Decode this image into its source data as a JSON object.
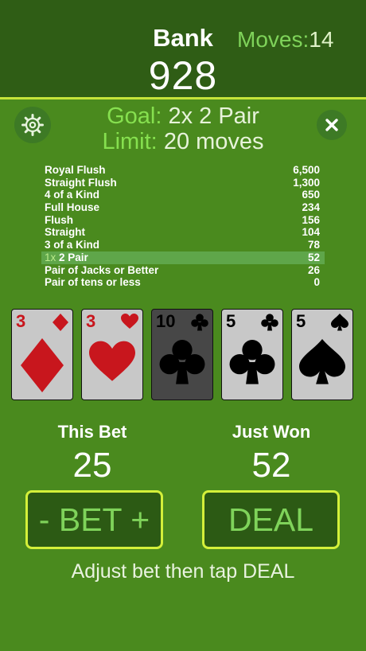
{
  "header": {
    "bank_label": "Bank",
    "bank_value": "928",
    "moves_label": "Moves:",
    "moves_value": "14"
  },
  "goal": {
    "goal_label": "Goal:",
    "goal_value": "2x 2 Pair",
    "limit_label": "Limit:",
    "limit_value": "20 moves"
  },
  "paytable": [
    {
      "hand": "Royal Flush",
      "payout": "6,500"
    },
    {
      "hand": "Straight Flush",
      "payout": "1,300"
    },
    {
      "hand": "4 of a Kind",
      "payout": "650"
    },
    {
      "hand": "Full House",
      "payout": "234"
    },
    {
      "hand": "Flush",
      "payout": "156"
    },
    {
      "hand": "Straight",
      "payout": "104"
    },
    {
      "hand": "3 of a Kind",
      "payout": "78"
    },
    {
      "prefix": "1x",
      "hand": "2 Pair",
      "payout": "52",
      "highlight": true
    },
    {
      "hand": "Pair of Jacks or Better",
      "payout": "26"
    },
    {
      "hand": "Pair of tens or less",
      "payout": "0"
    }
  ],
  "cards": [
    {
      "rank": "3",
      "suit": "diamond",
      "held": false
    },
    {
      "rank": "3",
      "suit": "heart",
      "held": false
    },
    {
      "rank": "10",
      "suit": "club",
      "held": true
    },
    {
      "rank": "5",
      "suit": "club",
      "held": false
    },
    {
      "rank": "5",
      "suit": "spade",
      "held": false
    }
  ],
  "bet": {
    "this_bet_label": "This Bet",
    "this_bet_value": "25",
    "just_won_label": "Just Won",
    "just_won_value": "52"
  },
  "buttons": {
    "bet_label": "- BET +",
    "deal_label": "DEAL"
  },
  "hint": "Adjust bet then tap DEAL",
  "colors": {
    "felt": "#4a8a1e",
    "header": "#2f5d15",
    "accent": "#d4f03a",
    "button_text": "#7fd35a",
    "red_suit": "#c8161d",
    "black_suit": "#000000"
  },
  "icons": {
    "settings": "gear-icon",
    "close": "close-icon"
  }
}
